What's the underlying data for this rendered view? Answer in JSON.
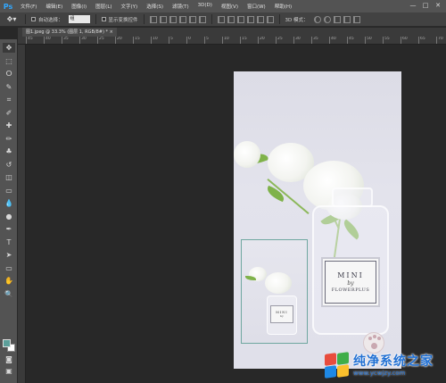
{
  "app": {
    "logo": "Ps"
  },
  "menu": {
    "items": [
      "文件(F)",
      "编辑(E)",
      "图像(I)",
      "图层(L)",
      "文字(Y)",
      "选择(S)",
      "滤镜(T)",
      "3D(D)",
      "视图(V)",
      "窗口(W)",
      "帮助(H)"
    ]
  },
  "window_controls": [
    "—",
    "□",
    "✕"
  ],
  "options_bar": {
    "tool_icon": "move-tool-icon",
    "auto_select_label": "自动选择：",
    "auto_select_value": "组",
    "show_transform_label": "显示变换控件",
    "mode_3d_label": "3D 模式："
  },
  "document_tab": {
    "label": "图1.jpeg @ 33.3% (图层 1, RGB/8#) * ×"
  },
  "ruler": {
    "labels": [
      "45",
      "40",
      "35",
      "30",
      "25",
      "20",
      "15",
      "10",
      "5",
      "0",
      "5",
      "10",
      "15",
      "20",
      "25",
      "30",
      "35",
      "40",
      "45",
      "50",
      "55",
      "60",
      "65",
      "70"
    ]
  },
  "tools": [
    "move-tool-icon",
    "marquee-tool-icon",
    "lasso-tool-icon",
    "quick-select-tool-icon",
    "crop-tool-icon",
    "eyedropper-tool-icon",
    "healing-brush-tool-icon",
    "brush-tool-icon",
    "clone-stamp-tool-icon",
    "history-brush-tool-icon",
    "eraser-tool-icon",
    "gradient-tool-icon",
    "blur-tool-icon",
    "dodge-tool-icon",
    "pen-tool-icon",
    "type-tool-icon",
    "path-select-tool-icon",
    "shape-tool-icon",
    "hand-tool-icon",
    "zoom-tool-icon"
  ],
  "tool_glyphs": [
    "✥",
    "⬚",
    "ⵔ",
    "✎",
    "⌗",
    "✐",
    "✚",
    "✏",
    "♣",
    "↺",
    "◫",
    "▭",
    "💧",
    "●",
    "✒",
    "T",
    "➤",
    "▭",
    "✋",
    "🔍"
  ],
  "colors": {
    "foreground": "#5c9f9a",
    "background": "#ffffff",
    "accent_blue": "#31a8ff"
  },
  "image": {
    "bottle_label_line1": "MINI",
    "bottle_label_line2": "by",
    "bottle_label_line3": "FLOWERPLUS",
    "thumb_label_line1": "MINI",
    "thumb_label_line2": "by"
  },
  "watermark": {
    "main": "纯净系统之家",
    "sub": "www.ycwjzy.com"
  }
}
